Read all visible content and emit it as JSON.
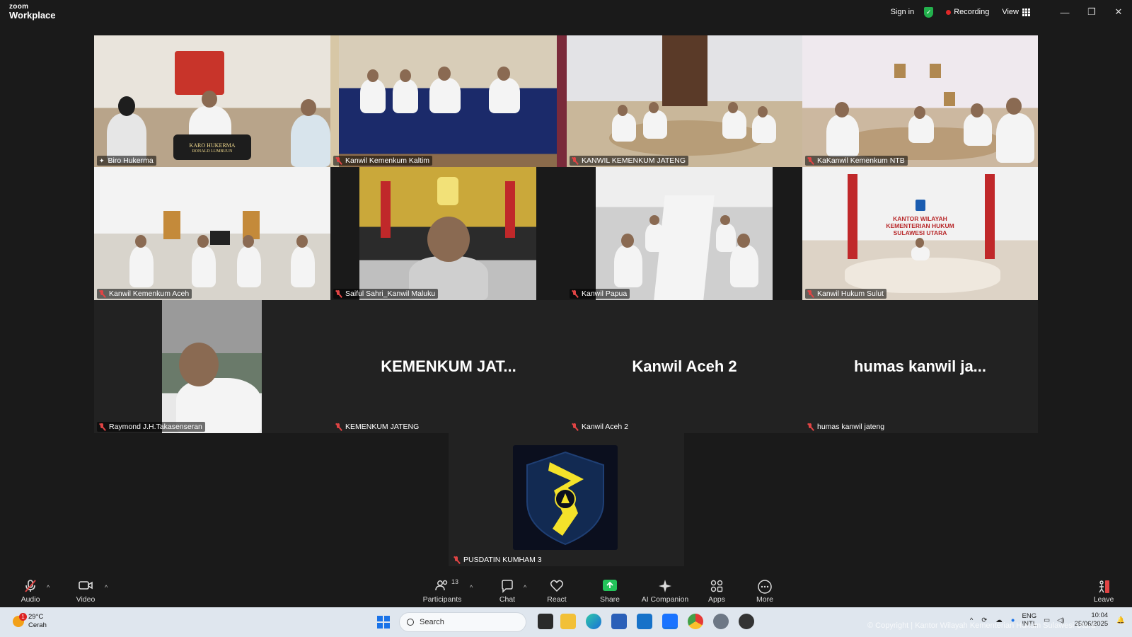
{
  "app": {
    "brand_top": "zoom",
    "brand_bottom": "Workplace",
    "sign_in": "Sign in",
    "recording": "Recording",
    "view": "View"
  },
  "participants": [
    {
      "name": "Biro Hukerma",
      "active": true
    },
    {
      "name": "Kanwil Kemenkum Kaltim"
    },
    {
      "name": "KANWIL KEMENKUM JATENG"
    },
    {
      "name": "KaKanwil Kemenkum NTB"
    },
    {
      "name": "Kanwil Kemenkum Aceh"
    },
    {
      "name": "Saiful Sahri_Kanwil Maluku"
    },
    {
      "name": "Kanwil Papua"
    },
    {
      "name": "Kanwil Hukum Sulut"
    },
    {
      "name": "Raymond J.H.Takasenseran"
    },
    {
      "name": "KEMENKUM JATENG",
      "display": "KEMENKUM  JAT..."
    },
    {
      "name": "Kanwil Aceh 2",
      "display": "Kanwil Aceh 2"
    },
    {
      "name": "humas kanwil jateng",
      "display": "humas kanwil ja..."
    },
    {
      "name": "PUSDATIN KUMHAM 3"
    }
  ],
  "scene_text": {
    "karo_plate_1": "KARO HUKERMA",
    "karo_plate_2": "RONALD LUMBUUN",
    "sulut_sign_1": "KANTOR WILAYAH",
    "sulut_sign_2": "KEMENTERIAN HUKUM",
    "sulut_sign_3": "SULAWESI UTARA"
  },
  "toolbar": {
    "audio": "Audio",
    "video": "Video",
    "participants": "Participants",
    "participant_count": "13",
    "chat": "Chat",
    "react": "React",
    "share": "Share",
    "ai_companion": "AI Companion",
    "apps": "Apps",
    "more": "More",
    "leave": "Leave"
  },
  "taskbar": {
    "weather_temp": "29°C",
    "weather_desc": "Cerah",
    "weather_badge": "1",
    "search": "Search",
    "lang_1": "ENG",
    "lang_2": "INTL",
    "time": "10:04",
    "date": "25/06/2025"
  },
  "watermark": "© Copyright | Kantor Wilayah Kementerian Hukum Sulawesi Utara",
  "colors": {
    "active_speaker": "#2ec26a",
    "muted_icon": "#e04444",
    "share_green": "#23c35a",
    "recording_dot": "#e02828"
  }
}
